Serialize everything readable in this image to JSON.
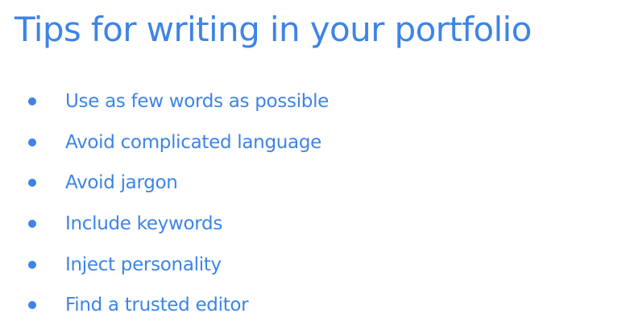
{
  "slide": {
    "title": "Tips for writing in your portfolio",
    "accent_color": "#3d84e6",
    "bullets": [
      {
        "text": "Use as few words as possible"
      },
      {
        "text": "Avoid complicated language"
      },
      {
        "text": "Avoid jargon"
      },
      {
        "text": "Include keywords"
      },
      {
        "text": "Inject personality"
      },
      {
        "text": "Find a trusted editor"
      }
    ]
  }
}
